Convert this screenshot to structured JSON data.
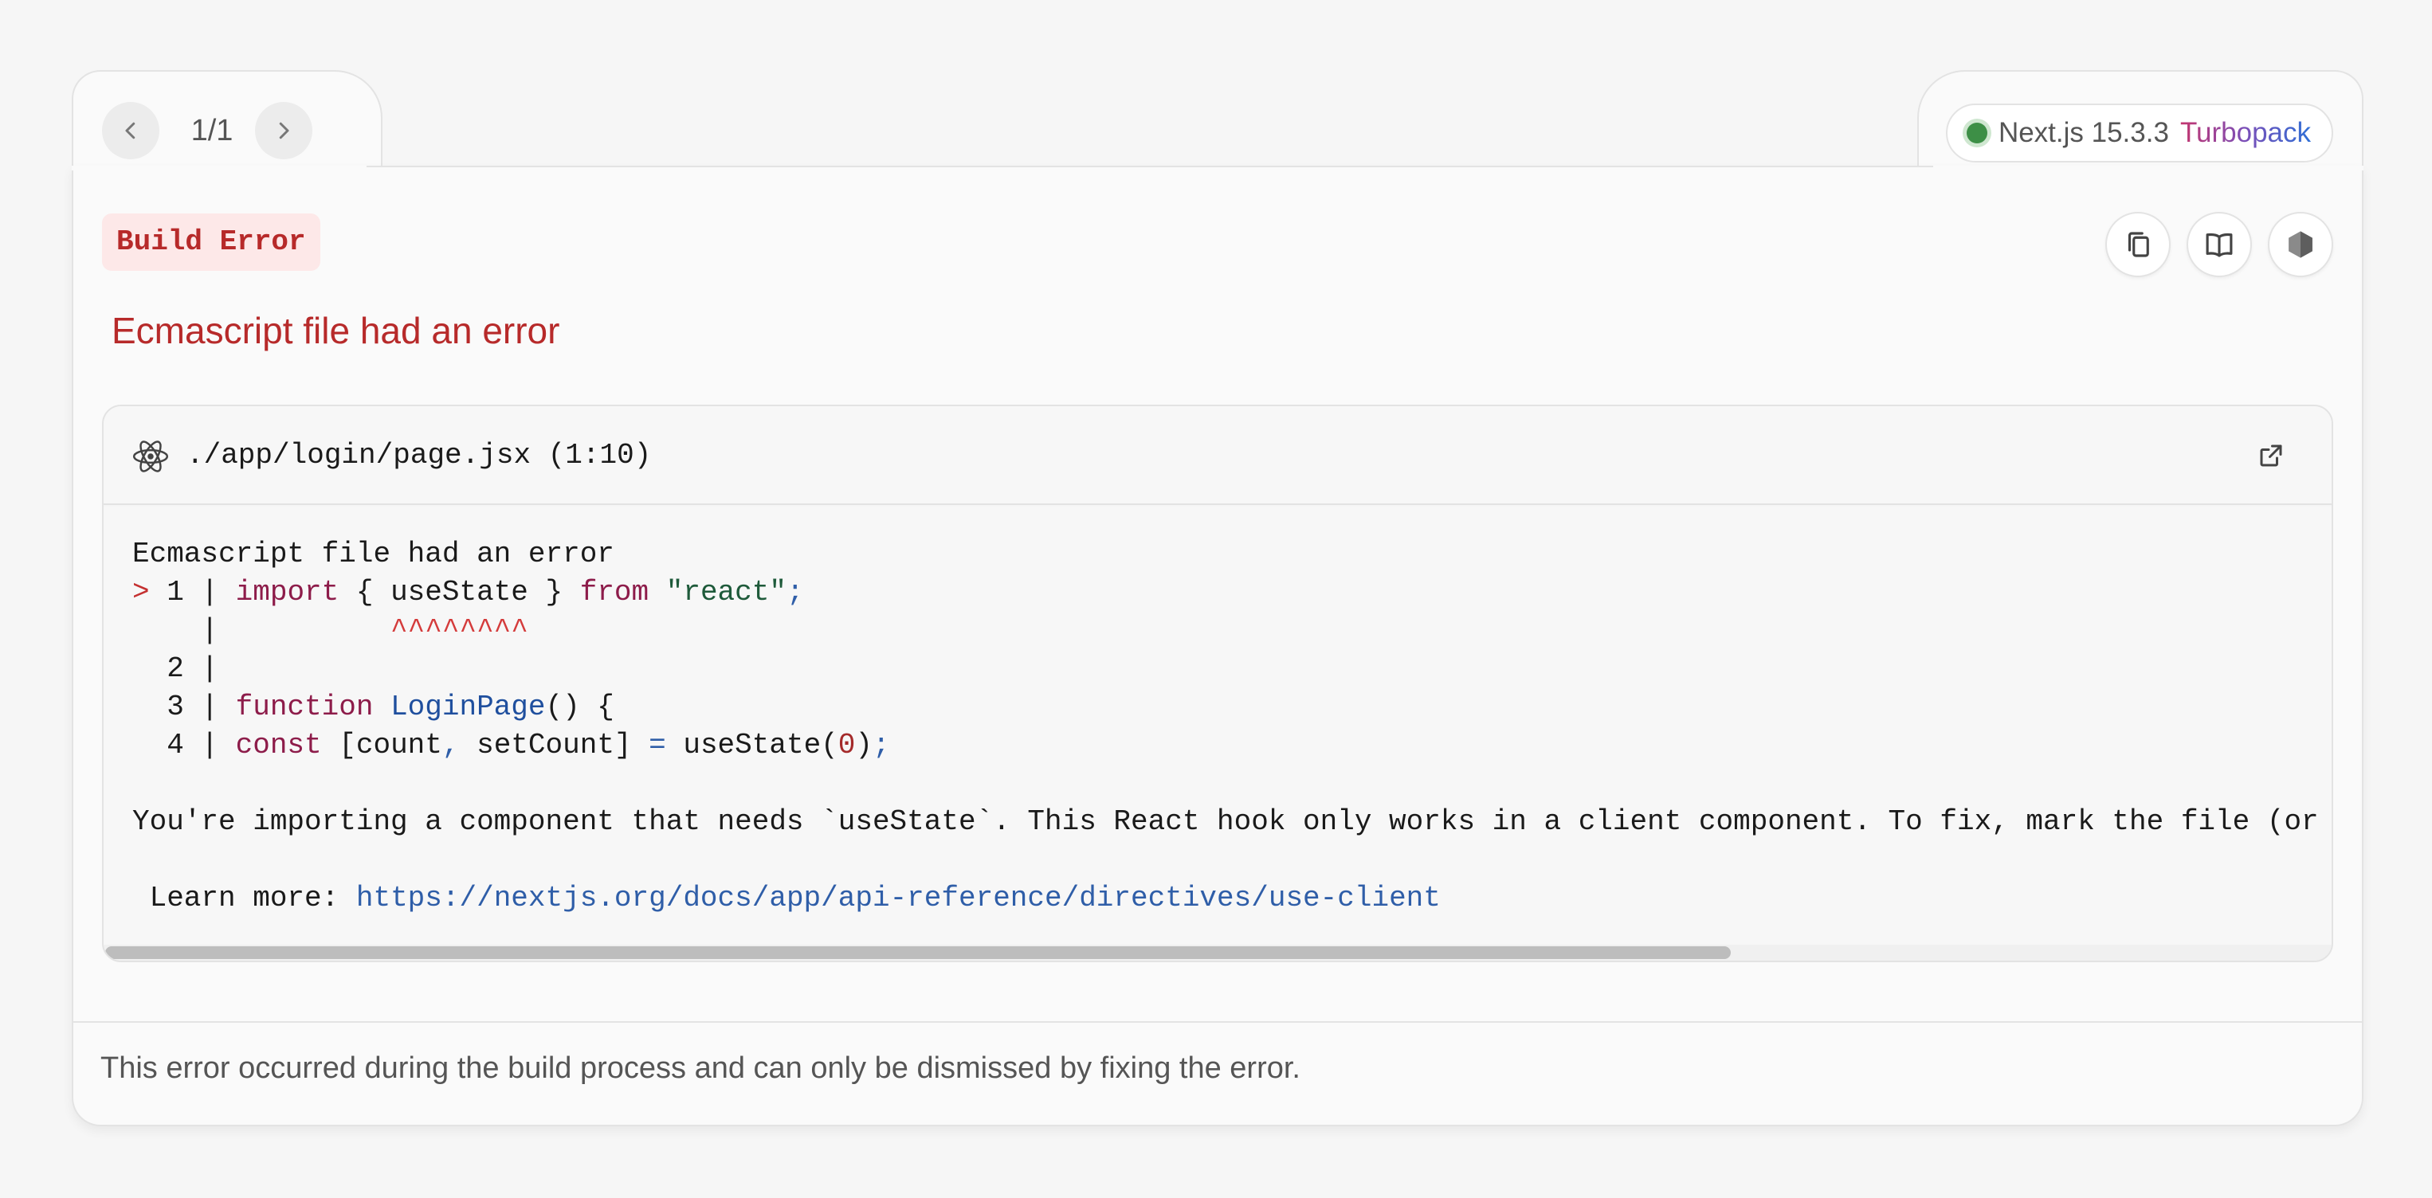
{
  "nav": {
    "pager": "1/1"
  },
  "version": {
    "label": "Next.js 15.3.3",
    "bundler": "Turbopack",
    "status_color": "#3d8f46"
  },
  "error": {
    "badge": "Build Error",
    "title": "Ecmascript file had an error"
  },
  "actions": {
    "copy_icon": "copy-icon",
    "docs_icon": "book-open-icon",
    "nextjs_icon": "nextjs-hexagon-icon"
  },
  "code_frame": {
    "file_icon": "react-icon",
    "file_path": "./app/login/page.jsx (1:10)",
    "heading": "Ecmascript file had an error",
    "lines": {
      "l1_marker": "> ",
      "l1_num": "1 | ",
      "l1_kw1": "import",
      "l1_mid": " { useState } ",
      "l1_kw2": "from",
      "l1_str": "\"react\"",
      "l1_semi": ";",
      "caret_gutter": "    | ",
      "caret": "         ^^^^^^^^",
      "l2": "  2 |",
      "l3_num": "  3 | ",
      "l3_kw": "function",
      "l3_fn": "LoginPage",
      "l3_rest": "() {",
      "l4_num": "  4 | ",
      "l4_kw": "const",
      "l4_a": " [count",
      "l4_comma": ",",
      "l4_b": " setCount] ",
      "l4_eq": "=",
      "l4_c": " useState(",
      "l4_num_val": "0",
      "l4_d": ")",
      "l4_semi": ";"
    },
    "message": "You're importing a component that needs `useState`. This React hook only works in a client component. To fix, mark the file (or",
    "learn_more_label": " Learn more: ",
    "learn_more_url": "https://nextjs.org/docs/app/api-reference/directives/use-client"
  },
  "footer": {
    "text": "This error occurred during the build process and can only be dismissed by fixing the error."
  }
}
